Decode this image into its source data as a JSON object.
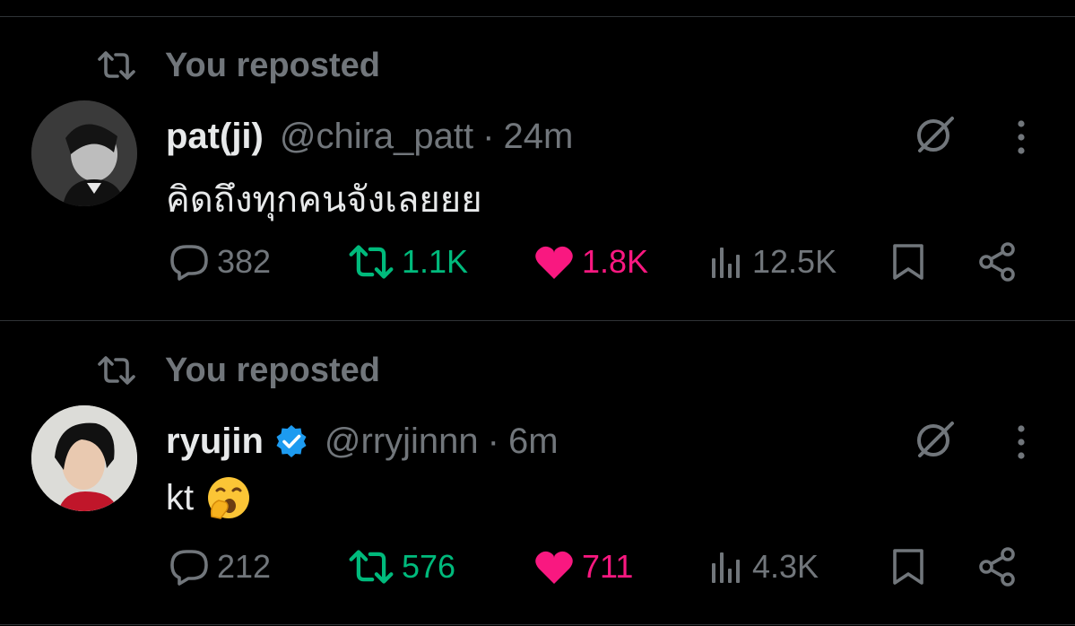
{
  "posts": [
    {
      "repost_label": "You reposted",
      "author_name": "pat(ji)",
      "handle": "@chira_patt",
      "separator": "·",
      "time": "24m",
      "verified": false,
      "text": "คิดถึงทุกคนจังเลยยย",
      "emoji": "",
      "replies": "382",
      "reposts": "1.1K",
      "likes": "1.8K",
      "views": "12.5K"
    },
    {
      "repost_label": "You reposted",
      "author_name": "ryujin",
      "handle": "@rryjinnn",
      "separator": "·",
      "time": "6m",
      "verified": true,
      "text": "kt",
      "emoji": "🥱",
      "replies": "212",
      "reposts": "576",
      "likes": "711",
      "views": "4.3K"
    }
  ],
  "colors": {
    "background": "#000000",
    "muted": "#71767b",
    "repost_active": "#00ba7c",
    "like_active": "#f91880",
    "verified": "#1d9bf0"
  },
  "icons": [
    "repost-icon",
    "grok-icon",
    "more-icon",
    "reply-icon",
    "like-icon",
    "views-icon",
    "bookmark-icon",
    "share-icon",
    "verified-badge-icon"
  ]
}
